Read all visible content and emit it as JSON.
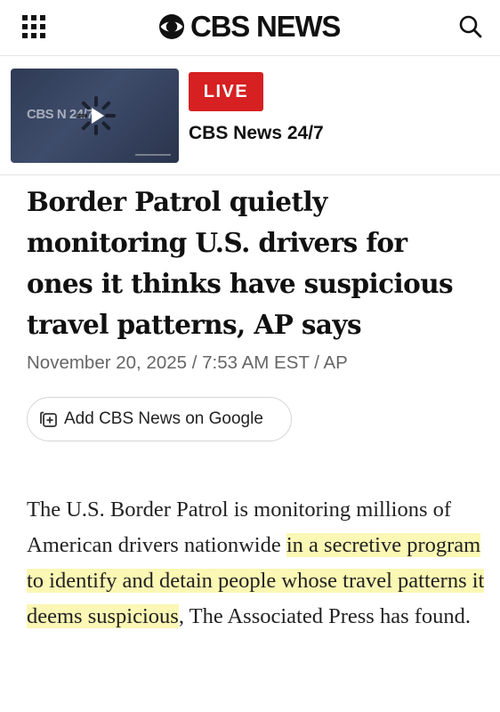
{
  "header": {
    "menu_icon": "grid-menu-icon",
    "brand": "CBS NEWS",
    "search_icon": "search-icon"
  },
  "live": {
    "thumbnail_text": "CBS N 24/7",
    "badge": "LIVE",
    "title": "CBS News 24/7"
  },
  "article": {
    "headline": "Border Patrol quietly monitoring U.S. drivers for ones it thinks have suspicious travel patterns, AP says",
    "byline": "November 20, 2025 / 7:53 AM EST / AP",
    "google_button": "Add CBS News on Google",
    "body_before": "The U.S. Border Patrol is monitoring millions of American drivers nationwide ",
    "body_highlight": "in a secretive program to identify and detain people whose travel patterns it deems suspicious",
    "body_after": ", The Associated Press has found."
  },
  "colors": {
    "live_red": "#d62021",
    "highlight": "#fbf7b4",
    "byline_gray": "#666666"
  }
}
